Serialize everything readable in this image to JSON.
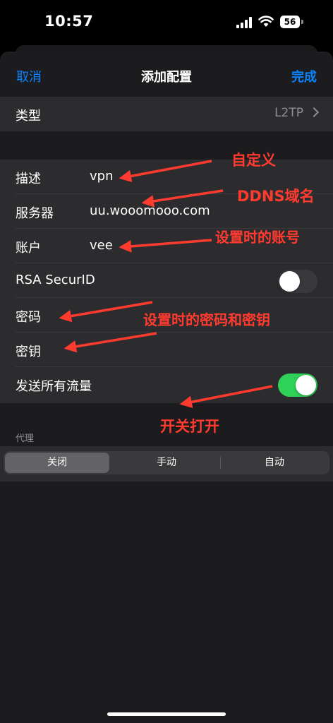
{
  "status_bar": {
    "time": "10:57",
    "battery": "56"
  },
  "nav": {
    "cancel": "取消",
    "title": "添加配置",
    "done": "完成"
  },
  "type_row": {
    "label": "类型",
    "value": "L2TP"
  },
  "fields": {
    "description": {
      "label": "描述",
      "value": "vpn"
    },
    "server": {
      "label": "服务器",
      "value": "uu.wooomooo.com"
    },
    "account": {
      "label": "账户",
      "value": "vee"
    },
    "rsa": {
      "label": "RSA SecurID",
      "enabled": false
    },
    "password": {
      "label": "密码"
    },
    "secret": {
      "label": "密钥"
    },
    "send_all": {
      "label": "发送所有流量",
      "enabled": true
    }
  },
  "proxy": {
    "header": "代理",
    "options": [
      "关闭",
      "手动",
      "自动"
    ],
    "selected": "关闭"
  },
  "annotations": {
    "custom": "自定义",
    "ddns": "DDNS域名",
    "account_note": "设置时的账号",
    "password_note": "设置时的密码和密钥",
    "toggle_note": "开关打开"
  },
  "colors": {
    "accent": "#0a84ff",
    "toggle_on": "#30d158",
    "annotation": "#ff3b30"
  }
}
